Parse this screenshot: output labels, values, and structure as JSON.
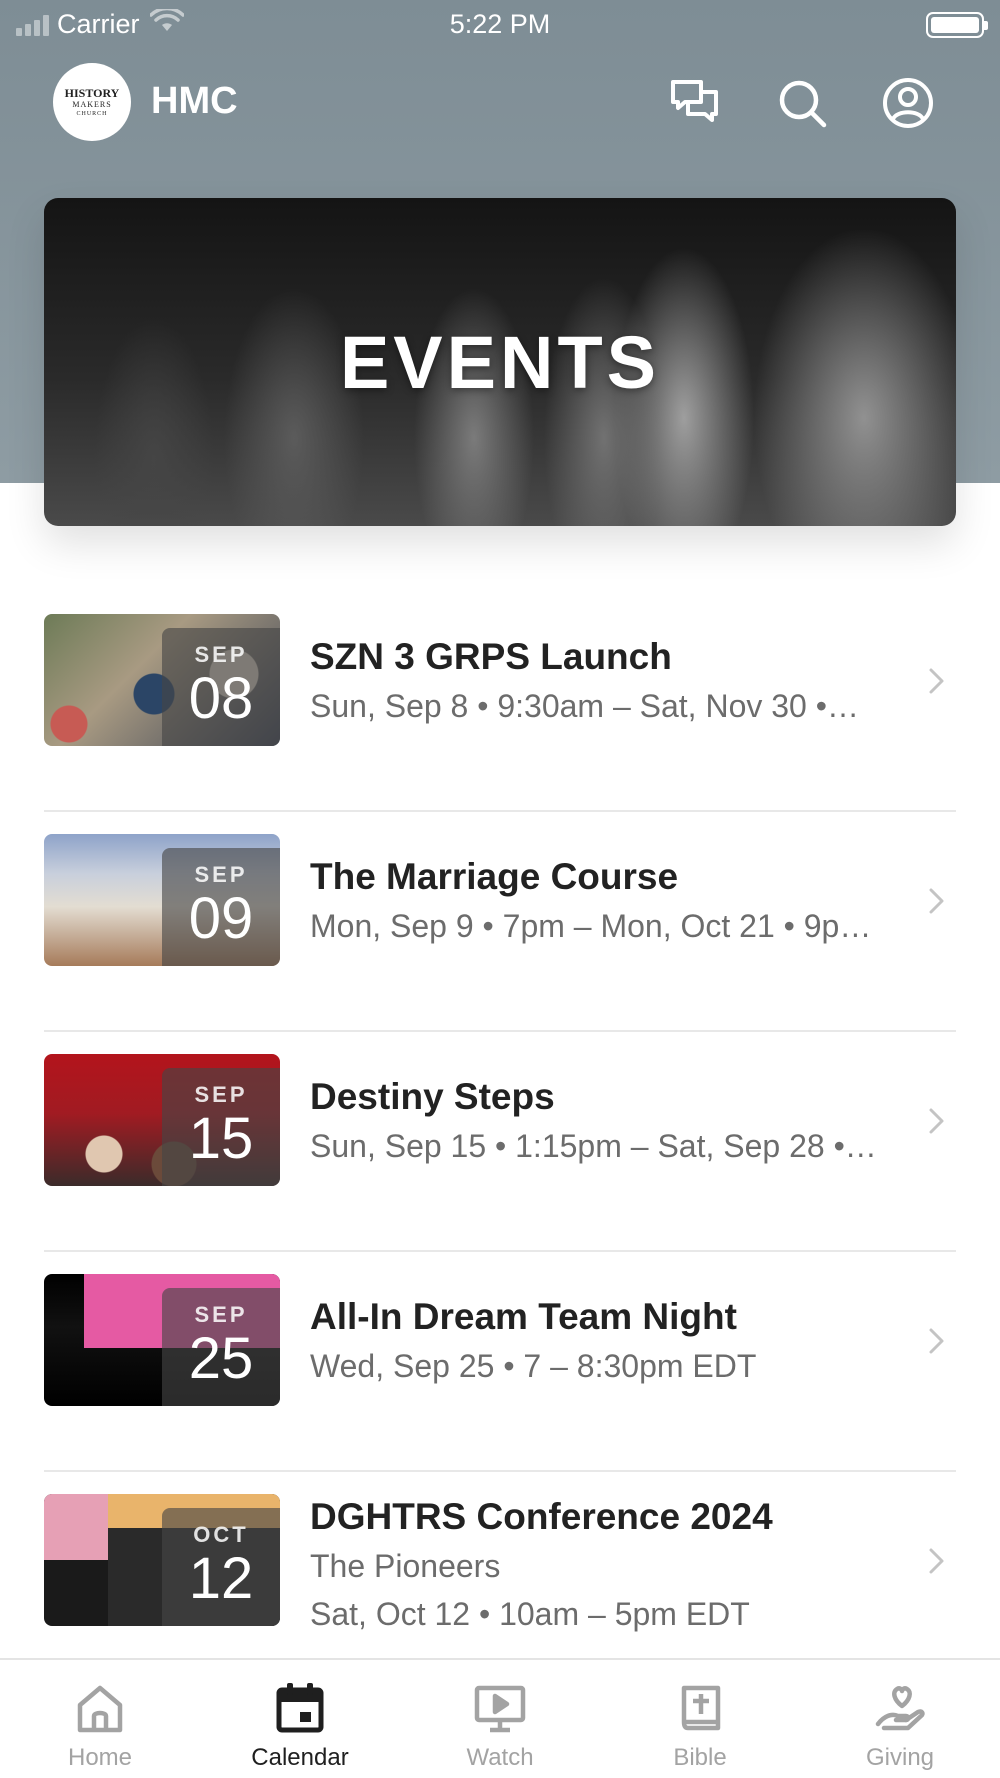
{
  "status_bar": {
    "carrier": "Carrier",
    "time": "5:22 PM"
  },
  "header": {
    "app_name": "HMC",
    "logo": {
      "line1": "HISTORY",
      "line2": "MAKERS",
      "line3": "CHURCH"
    },
    "icons": [
      "chat-icon",
      "search-icon",
      "profile-icon"
    ]
  },
  "hero": {
    "title": "EVENTS"
  },
  "events": [
    {
      "title": "SZN 3 GRPS Launch",
      "month": "SEP",
      "day": "08",
      "subtitle": "Sun, Sep 8 • 9:30am – Sat, Nov 30 •…",
      "subtitle2": ""
    },
    {
      "title": "The Marriage Course",
      "month": "SEP",
      "day": "09",
      "subtitle": "Mon, Sep 9 • 7pm – Mon, Oct 21 • 9p…",
      "subtitle2": ""
    },
    {
      "title": "Destiny Steps",
      "month": "SEP",
      "day": "15",
      "subtitle": "Sun, Sep 15 • 1:15pm – Sat, Sep 28 •…",
      "subtitle2": ""
    },
    {
      "title": "All-In Dream Team Night",
      "month": "SEP",
      "day": "25",
      "subtitle": "Wed, Sep 25 • 7 – 8:30pm EDT",
      "subtitle2": ""
    },
    {
      "title": "DGHTRS Conference 2024",
      "month": "OCT",
      "day": "12",
      "subtitle": "The Pioneers",
      "subtitle2": "Sat, Oct 12 • 10am – 5pm EDT"
    }
  ],
  "tab_bar": {
    "tabs": [
      {
        "label": "Home",
        "icon": "home-icon",
        "active": false
      },
      {
        "label": "Calendar",
        "icon": "calendar-icon",
        "active": true
      },
      {
        "label": "Watch",
        "icon": "watch-icon",
        "active": false
      },
      {
        "label": "Bible",
        "icon": "bible-icon",
        "active": false
      },
      {
        "label": "Giving",
        "icon": "giving-icon",
        "active": false
      }
    ]
  },
  "colors": {
    "header_bg": "#8a98a0",
    "active_tab": "#1f1f1f",
    "inactive_tab": "#a3a3a3"
  }
}
